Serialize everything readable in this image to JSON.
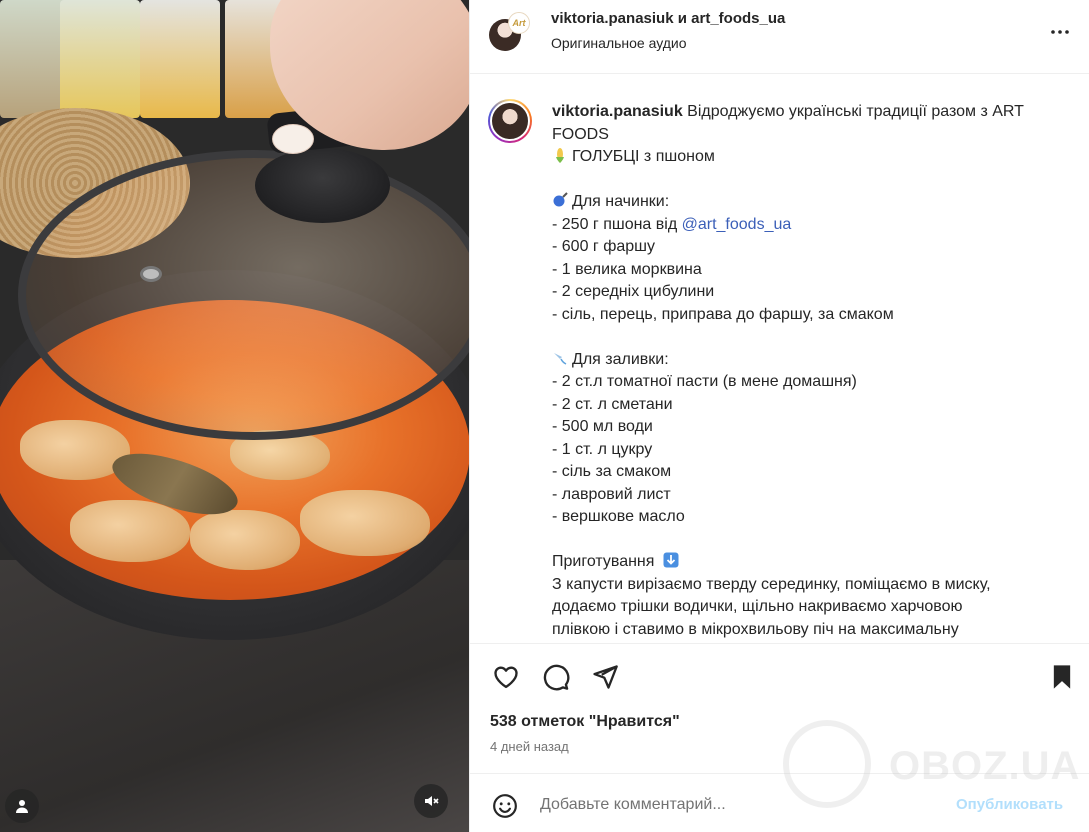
{
  "header": {
    "user1": "viktoria.panasiuk",
    "joiner": "и",
    "user2": "art_foods_ua",
    "audio": "Оригинальное аудио",
    "collab_logo": "Art"
  },
  "caption": {
    "username": "viktoria.panasiuk",
    "intro": "Відроджуємо українські традиції разом з ART FOODS",
    "dish": "ГОЛУБЦІ з пшоном",
    "filling_title": "Для начинки:",
    "filling": [
      {
        "prefix": "- 250 г пшона від ",
        "mention": "@art_foods_ua"
      },
      {
        "text": "- 600 г фаршу"
      },
      {
        "text": "- 1 велика морквина"
      },
      {
        "text": "- 2 середніх цибулини"
      },
      {
        "text": "- сіль, перець, приправа до фаршу, за смаком"
      }
    ],
    "sauce_title": "Для заливки:",
    "sauce": [
      "- 2 ст.л томатної пасти (в мене домашня)",
      "- 2 ст. л сметани",
      "- 500 мл води",
      "- 1 ст. л цукру",
      "- сіль за смаком",
      "- лавровий лист",
      "- вершкове масло"
    ],
    "method_title": "Приготування",
    "method": [
      "З капусти вирізаємо тверду серединку, поміщаємо в миску,",
      "додаємо трішки водички, щільно накриваємо харчовою",
      "плівкою і ставимо в мікрохвильову піч на максимальну"
    ]
  },
  "actions": {
    "likes": "538 отметок \"Нравится\"",
    "date": "4 дней назад"
  },
  "comment": {
    "placeholder": "Добавьте комментарий...",
    "publish": "Опубликовать"
  },
  "watermark": {
    "text": "OBOZ.UA"
  },
  "icons": {
    "media_user": "user-icon",
    "media_mute": "muted-speaker-icon",
    "more": "more-horizontal-icon",
    "like": "heart-icon",
    "comment": "comment-bubble-icon",
    "share": "paper-plane-icon",
    "save": "bookmark-icon",
    "emoji": "smiley-icon",
    "corn": "corn-icon",
    "pan": "frying-pan-icon",
    "pouring": "pouring-icon",
    "arrow_down": "down-arrow-icon"
  },
  "colors": {
    "link": "#3b5fb8",
    "publish_disabled": "#b2dffc",
    "muted_text": "#737373",
    "text": "#262626"
  }
}
